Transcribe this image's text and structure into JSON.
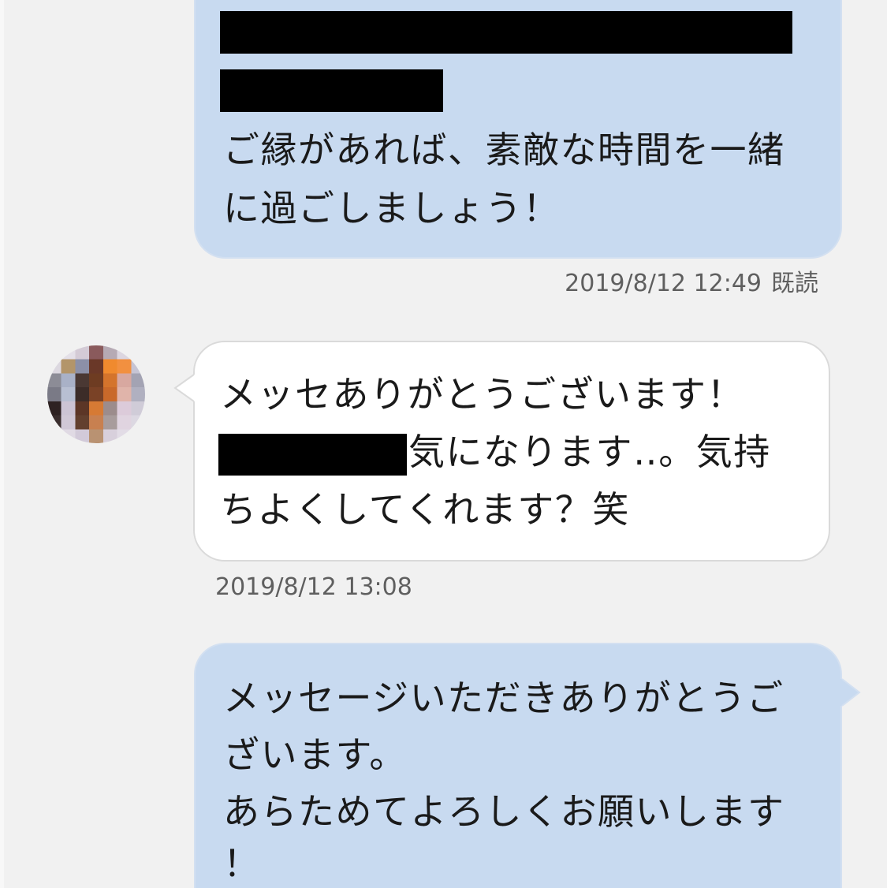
{
  "colors": {
    "background": "#f1f1f1",
    "sent_bubble": "#c8daf0",
    "received_bubble": "#ffffff",
    "timestamp": "#5f5f5f",
    "text": "#1a1a1a",
    "redaction": "#000000"
  },
  "chat": {
    "outgoing_1": {
      "lines": [
        "ご縁があれば、素敵な時間を一緒",
        "に過ごしましょう！"
      ],
      "timestamp": "2019/8/12 12:49",
      "read_status": "既読"
    },
    "incoming_1": {
      "lines": [
        "メッセありがとうございます！",
        "気になります‥。気持",
        "ちよくしてくれます？笑"
      ],
      "timestamp": "2019/8/12 13:08"
    },
    "outgoing_2": {
      "lines": [
        "メッセージいただきありがとうご",
        "ざいます。",
        "あらためてよろしくお願いします",
        "！"
      ]
    }
  }
}
